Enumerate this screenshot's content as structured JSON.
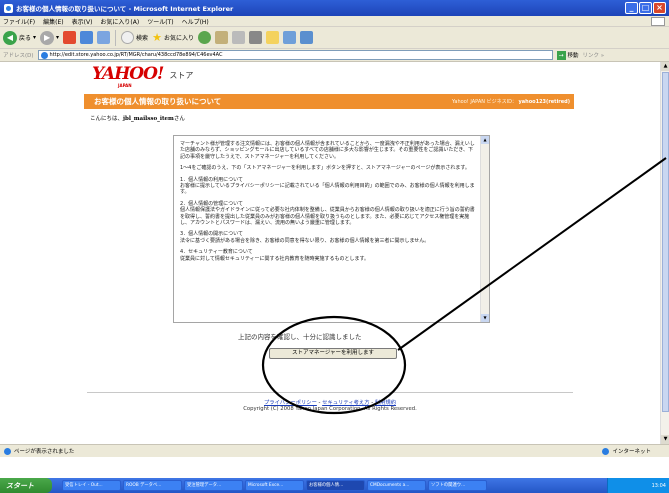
{
  "window": {
    "title": "お客様の個人情報の取り扱いについて - Microsoft Internet Explorer",
    "buttons": [
      "_",
      "□",
      "×"
    ]
  },
  "menu": [
    "ファイル(F)",
    "編集(E)",
    "表示(V)",
    "お気に入り(A)",
    "ツール(T)",
    "ヘルプ(H)"
  ],
  "toolbar": {
    "back_label": "戻る",
    "search_label": "検索",
    "favorites_label": "お気に入り"
  },
  "address": {
    "label": "アドレス(D)",
    "url": "http://edit.store.yahoo.co.jp/RT/MGR/charu/438ccd78e894/C46ev4AC",
    "go_label": "移動",
    "links_label": "リンク »"
  },
  "page": {
    "logo": "YAHOO!",
    "logo_sub": "JAPAN",
    "store_label": "ストア",
    "banner_title": "お客様の個人情報の取り扱いについて",
    "banner_right_prefix": "Yahoo! JAPAN ビジネスID：",
    "banner_right_id": "yahoo123(retired)",
    "greeting_prefix": "こんにちは、",
    "greeting_name": "jbl_mailsso_item",
    "greeting_suffix": "さん",
    "paragraphs": [
      "マーチャント様が管理する注文情報には、お客様の個人情報が含まれていることから、一度漏洩や不正利用があった場合、漏えいした店舗のみならず、ショッピングモールに出店しているすべての店舗様に多大な影響が生じます。その重要性をご認識いただき、下記の事項を厳守したうえで、ストアマネージャーを利用してください。",
      "1～4をご確認のうえ、下の「ストアマネージャーを利用します」ボタンを押すと、ストアマネージャーのページが表示されます。",
      "1．個人情報の利用について\nお客様に提示しているプライバシーポリシーに記載されている「個人情報の利用目的」の範囲でのみ、お客様の個人情報を利用します。",
      "2．個人情報の管理について\n個人情報保護法やガイドラインに従って必要な社内体制を整備し、従業員からお客様の個人情報の取り扱いを適正に行う旨の誓約書を取得し、誓約書を提出した従業員のみがお客様の個人情報を取り扱うものとします。また、必要に応じてアクセス権管理を実施し、アカウントとパスワードは、漏えい、流用の無いよう厳重に管理します。",
      "3．個人情報の開示について\n法令に基づく要請がある場合を除き、お客様の同意を得ない限り、お客様の個人情報を第三者に開示しません。",
      "4．セキュリティー教育について\n従業員に対して情報セキュリティーに関する社内教育を随時実施するものとします。"
    ],
    "confirm_text": "上記の内容を確認し、十分に認識しました",
    "agree_button": "ストアマネージャーを利用します",
    "footer_links": [
      "プライバシーポリシー",
      "セキュリティ考え方",
      "利用規約"
    ],
    "footer_sep": " - ",
    "copyright": "Copyright (C) 2008 Yahoo Japan Corporation. All Rights Reserved."
  },
  "status": {
    "text": "ページが表示されました",
    "zone": "インターネット"
  },
  "taskbar": {
    "start": "スタート",
    "items": [
      "受信トレイ - Out...",
      "ROOB データベ...",
      "受注管理データ...",
      "Microsoft Exce...",
      "お客様の個人情...",
      "CMDocuments a...",
      "ソフトの関連ウ..."
    ],
    "clock": "13:04"
  },
  "colors": {
    "banner": "#ef8f2e",
    "logo": "#d60000",
    "annotation": "#000000"
  }
}
